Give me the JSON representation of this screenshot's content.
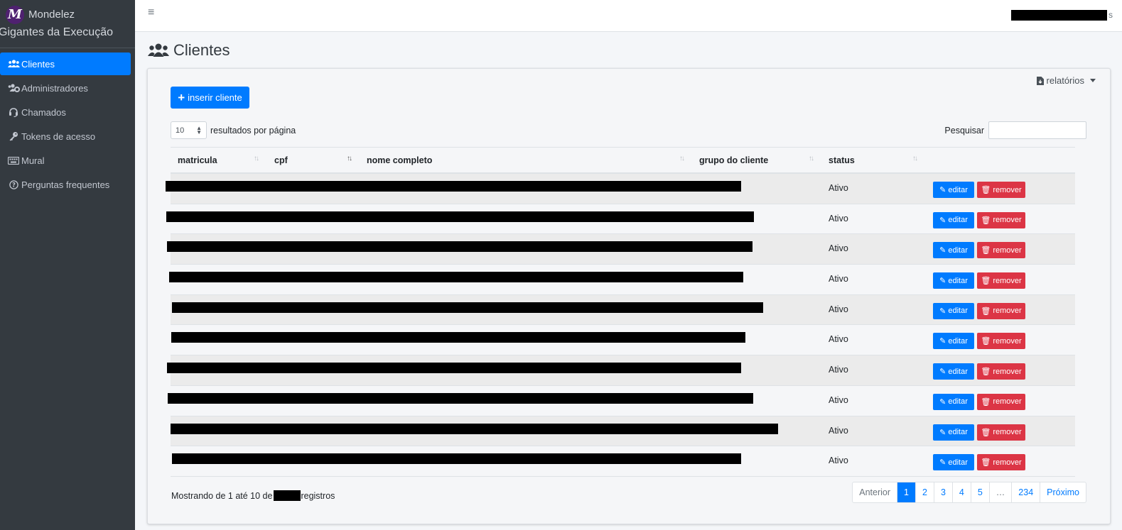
{
  "sidebar": {
    "brand_logo": "M",
    "brand_name": "Mondelez",
    "brand_sub": "Gigantes da Execução",
    "items": [
      {
        "label": "Clientes",
        "icon": "users-icon",
        "active": true
      },
      {
        "label": "Administradores",
        "icon": "users-cog-icon",
        "active": false
      },
      {
        "label": "Chamados",
        "icon": "headset-icon",
        "active": false
      },
      {
        "label": "Tokens de acesso",
        "icon": "key-icon",
        "active": false
      },
      {
        "label": "Mural",
        "icon": "keyboard-icon",
        "active": false
      },
      {
        "label": "Perguntas frequentes",
        "icon": "question-circle-icon",
        "active": false
      }
    ]
  },
  "topbar": {
    "menu_icon": "≡",
    "user_suffix": "s"
  },
  "page": {
    "title": "Clientes"
  },
  "card": {
    "reports_label": "relatórios",
    "insert_label": "inserir cliente",
    "length_value": "10",
    "length_label": "resultados por página",
    "search_label": "Pesquisar",
    "search_value": ""
  },
  "table": {
    "columns": [
      "matricula",
      "cpf",
      "nome completo",
      "grupo do cliente",
      "status"
    ],
    "rows": [
      {
        "status": "Ativo"
      },
      {
        "status": "Ativo"
      },
      {
        "status": "Ativo"
      },
      {
        "status": "Ativo"
      },
      {
        "status": "Ativo"
      },
      {
        "status": "Ativo"
      },
      {
        "status": "Ativo"
      },
      {
        "status": "Ativo"
      },
      {
        "status": "Ativo"
      },
      {
        "status": "Ativo"
      }
    ],
    "edit_label": "editar",
    "remove_label": "remover"
  },
  "footer": {
    "info_prefix": "Mostrando de 1 até 10 de",
    "info_suffix": "registros"
  },
  "pagination": {
    "prev": "Anterior",
    "pages": [
      "1",
      "2",
      "3",
      "4",
      "5",
      "…",
      "234"
    ],
    "active": "1",
    "next": "Próximo"
  },
  "colors": {
    "sidebar_bg": "#343a40",
    "primary": "#007bff",
    "danger": "#dc3545"
  }
}
